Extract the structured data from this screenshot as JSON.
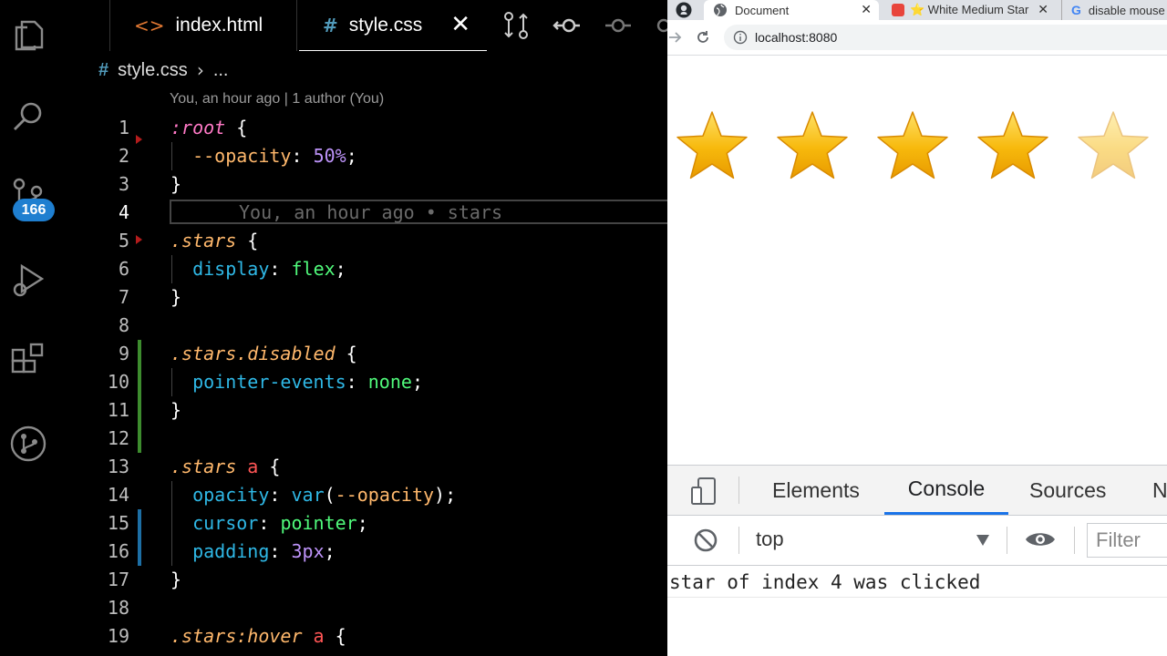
{
  "editor": {
    "tabs": [
      {
        "label": "index.html",
        "icon": "code-icon"
      },
      {
        "label": "style.css",
        "icon": "hash-icon"
      }
    ],
    "badge_count": "166",
    "breadcrumb": {
      "file": "style.css",
      "more": "..."
    },
    "blame": "You, an hour ago | 1 author (You)",
    "ghost_blame": "You, an hour ago • stars",
    "line_numbers": [
      "1",
      "2",
      "3",
      "4",
      "5",
      "6",
      "7",
      "8",
      "9",
      "10",
      "11",
      "12",
      "13",
      "14",
      "15",
      "16",
      "17",
      "18",
      "19"
    ],
    "code": {
      "l1_sel": ":root",
      "l1_brace": " {",
      "l2_prop": "--opacity",
      "l2_colon": ": ",
      "l2_val": "50%",
      "l2_semi": ";",
      "l3": "}",
      "l5_sel": ".stars",
      "l5_brace": " {",
      "l6_prop": "display",
      "l6_colon": ": ",
      "l6_val": "flex",
      "l6_semi": ";",
      "l7": "}",
      "l9_sel": ".stars.disabled",
      "l9_brace": " {",
      "l10_prop": "pointer-events",
      "l10_colon": ": ",
      "l10_val": "none",
      "l10_semi": ";",
      "l11": "}",
      "l13_sel": ".stars",
      "l13_tag": " a",
      "l13_brace": " {",
      "l14_prop": "opacity",
      "l14_colon": ": ",
      "l14_fn": "var",
      "l14_open": "(",
      "l14_arg": "--opacity",
      "l14_close": ");",
      "l15_prop": "cursor",
      "l15_colon": ": ",
      "l15_val": "pointer",
      "l15_semi": ";",
      "l16_prop": "padding",
      "l16_colon": ": ",
      "l16_val": "3px",
      "l16_semi": ";",
      "l17": "}",
      "l19_sel": ".stars:hover",
      "l19_tag": " a",
      "l19_brace": " {"
    }
  },
  "browser": {
    "tabs": [
      {
        "label": "Document"
      },
      {
        "label": "⭐ White Medium Star"
      },
      {
        "label": "disable mouse"
      }
    ],
    "url": "localhost:8080",
    "stars": [
      {
        "rating_fraction": 1.0
      },
      {
        "rating_fraction": 1.0
      },
      {
        "rating_fraction": 1.0
      },
      {
        "rating_fraction": 1.0
      },
      {
        "rating_fraction": 0.5
      }
    ],
    "devtools": {
      "tabs": [
        "Elements",
        "Console",
        "Sources",
        "N"
      ],
      "context": "top",
      "filter_placeholder": "Filter",
      "log": "star of index 4 was clicked"
    }
  },
  "colors": {
    "badge": "#1f7fd0",
    "star_fill": "#f7b90c",
    "active_tab_indicator": "#1a73e8",
    "git_added": "#3d8c2e",
    "git_modified": "#1d6fa5"
  }
}
